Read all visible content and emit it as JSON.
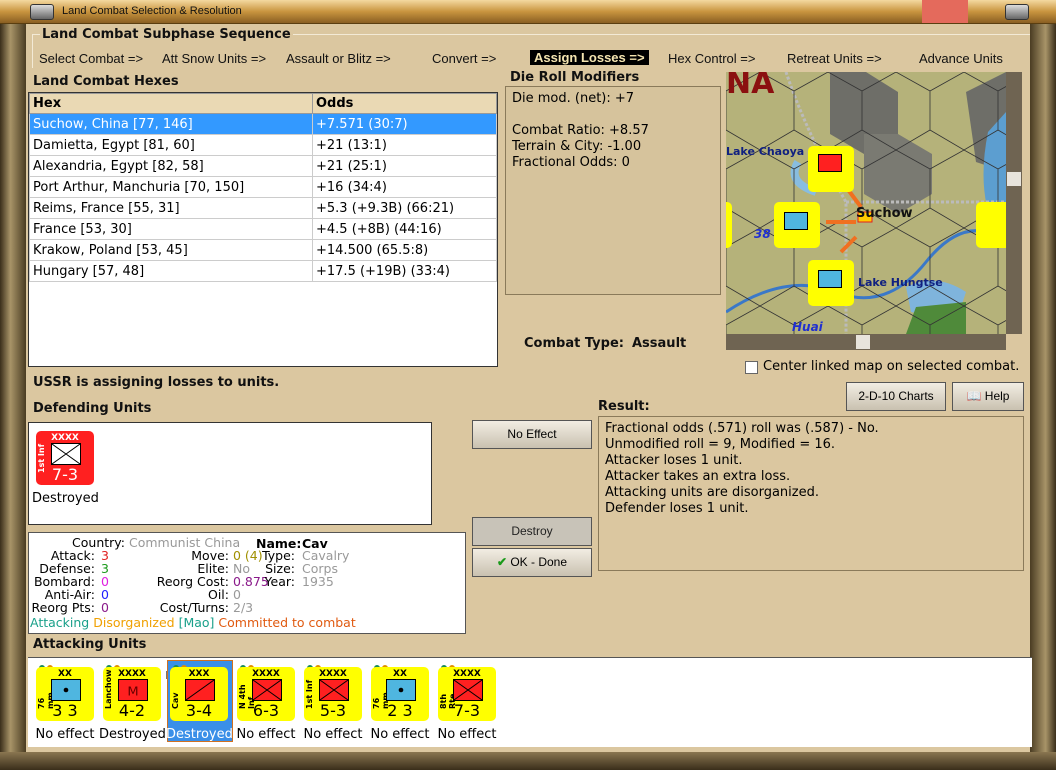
{
  "window": {
    "title": "Land Combat Selection & Resolution"
  },
  "subphase": {
    "title": "Land Combat Subphase Sequence",
    "steps": [
      "Select Combat =>",
      "Att Snow Units =>",
      "Assault or Blitz =>",
      "Convert =>",
      "Assign Losses =>",
      "Hex Control =>",
      "Retreat Units =>",
      "Advance Units"
    ],
    "active_index": 4
  },
  "hexes": {
    "title": "Land Combat Hexes",
    "columns": [
      "Hex",
      "Odds"
    ],
    "rows": [
      [
        "Suchow, China [77, 146]",
        "+7.571 (30:7)"
      ],
      [
        "Damietta, Egypt [81, 60]",
        "+21 (13:1)"
      ],
      [
        "Alexandria, Egypt [82, 58]",
        "+21 (25:1)"
      ],
      [
        "Port Arthur, Manchuria [70, 150]",
        "+16 (34:4)"
      ],
      [
        "Reims, France [55, 31]",
        "+5.3 (+9.3B) (66:21)"
      ],
      [
        "France [53, 30]",
        "+4.5 (+8B) (44:16)"
      ],
      [
        "Krakow, Poland [53, 45]",
        "+14.500 (65.5:8)"
      ],
      [
        "Hungary [57, 48]",
        "+17.5 (+19B) (33:4)"
      ]
    ],
    "selected_index": 0
  },
  "die_roll": {
    "title": "Die Roll Modifiers",
    "lines": [
      "Die mod. (net): +7",
      "",
      "Combat Ratio: +8.57",
      "Terrain & City: -1.00",
      "Fractional Odds: 0"
    ]
  },
  "combat_type": {
    "label": "Combat Type:",
    "value": "Assault"
  },
  "map": {
    "labels": [
      "NA",
      "Lake Chaoya",
      "Suchow",
      "38",
      "Lake Hungtse",
      "Huai"
    ],
    "center_linked_label": "Center linked map on selected combat.",
    "center_linked_checked": false
  },
  "status": "USSR is assigning losses to units.",
  "defending": {
    "title": "Defending Units",
    "units": [
      {
        "size": "XXXX",
        "name": "1st Inf",
        "strength": "7-3",
        "result": "Destroyed",
        "color": "#ff2020"
      }
    ]
  },
  "buttons": {
    "no_effect": "No Effect",
    "destroy": "Destroy",
    "ok": "OK - Done",
    "charts": "2-D-10 Charts",
    "help": "Help"
  },
  "result": {
    "title": "Result:",
    "lines": [
      "Fractional odds (.571) roll was (.587)  - No.",
      "Unmodified roll = 9, Modified = 16.",
      "Attacker loses 1 unit.",
      "Attacker takes an extra loss.",
      "Attacking units are disorganized.",
      "Defender loses 1 unit."
    ]
  },
  "info": {
    "country_label": "Country:",
    "country": "Communist China",
    "name_label": "Name:",
    "name": "Cav",
    "attack_label": "Attack:",
    "attack": "3",
    "defense_label": "Defense:",
    "defense": "3",
    "bombard_label": "Bombard:",
    "bombard": "0",
    "antiair_label": "Anti-Air:",
    "antiair": "0",
    "reorgpts_label": "Reorg Pts:",
    "reorgpts": "0",
    "move_label": "Move:",
    "move": "0 (4)",
    "elite_label": "Elite:",
    "elite": "No",
    "reorgcost_label": "Reorg Cost:",
    "reorgcost": "0.875",
    "oil_label": "Oil:",
    "oil": "0",
    "costturns_label": "Cost/Turns:",
    "costturns": "2/3",
    "type_label": "Type:",
    "type": "Cavalry",
    "size_label": "Size:",
    "size": "Corps",
    "year_label": "Year:",
    "year": "1935",
    "status1": "Attacking",
    "status2": "Disorganized",
    "status3": "[Mao]",
    "status4": "Committed to combat"
  },
  "attacking": {
    "title": "Attacking Units",
    "selected_index": 2,
    "units": [
      {
        "size": "XX",
        "name": "76 mm",
        "strength": "3 3",
        "result": "No effect",
        "box": "#4fb6e0"
      },
      {
        "size": "XXXX",
        "name": "Lanchow",
        "strength": "4-2",
        "result": "Destroyed",
        "box": "#ff2020",
        "mark": "M",
        "flag": "R"
      },
      {
        "size": "XXX",
        "name": "Cav",
        "strength": "3-4",
        "result": "Destroyed",
        "box": "#ff2020"
      },
      {
        "size": "XXXX",
        "name": "N 4th Inf",
        "strength": "6-3",
        "result": "No effect",
        "box": "#ff2020"
      },
      {
        "size": "XXXX",
        "name": "1st Inf",
        "strength": "5-3",
        "result": "No effect",
        "box": "#ff2020"
      },
      {
        "size": "XX",
        "name": "76 mm",
        "strength": "2 3",
        "result": "No effect",
        "box": "#4fb6e0"
      },
      {
        "size": "XXXX",
        "name": "8th Rte",
        "strength": "7-3",
        "result": "No effect",
        "box": "#ff2020"
      }
    ]
  }
}
